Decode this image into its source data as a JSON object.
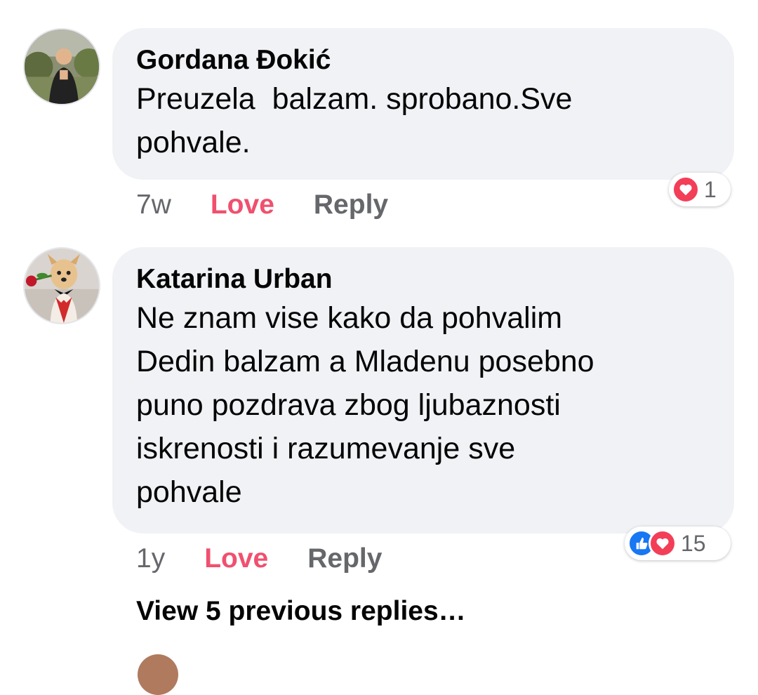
{
  "comments": [
    {
      "author": "Gordana Đokić",
      "text": "Preuzela  balzam. sprobano.Sve\npohvale.",
      "time": "7w",
      "love_label": "Love",
      "reply_label": "Reply",
      "reactions": [
        "heart-icon"
      ],
      "reaction_count": "1"
    },
    {
      "author": "Katarina Urban",
      "text": "Ne znam vise kako da pohvalim\nDedin balzam a Mladenu posebno\npuno pozdrava zbog ljubaznosti\niskrenosti i razumevanje sve\npohvale",
      "time": "1y",
      "love_label": "Love",
      "reply_label": "Reply",
      "reactions": [
        "like-icon",
        "heart-icon"
      ],
      "reaction_count": "15"
    }
  ],
  "view_previous_replies": "View 5 previous replies…",
  "colors": {
    "bubble": "#f0f2f5",
    "love_active": "#f0506e",
    "secondary_text": "#65676b",
    "like_blue": "#1877f2",
    "heart_red": "#f33e58"
  }
}
